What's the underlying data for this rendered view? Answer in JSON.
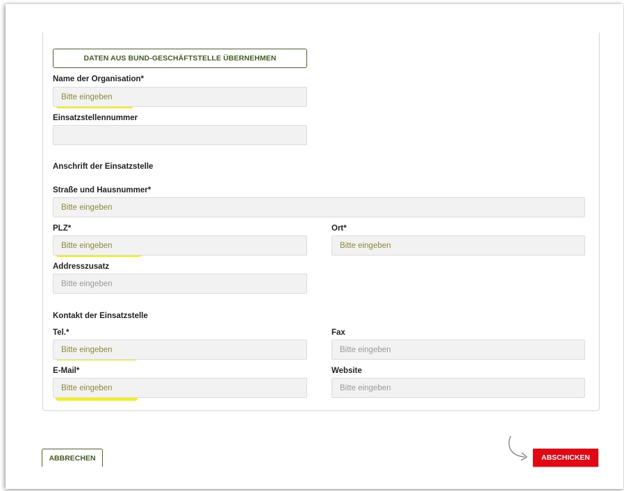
{
  "form": {
    "takeover_button_label": "DATEN AUS BUND-GESCHÄFTSTELLE ÜBERNEHMEN",
    "placeholder": "Bitte eingeben",
    "fields": {
      "organisation_name": {
        "label": "Name der Organisation*",
        "value": "",
        "highlighted": true
      },
      "einsatzstellennummer": {
        "label": "Einsatzstellennummer",
        "value": "",
        "highlighted": false
      },
      "strasse": {
        "label": "Straße und Hausnummer*",
        "value": "",
        "highlighted": true
      },
      "plz": {
        "label": "PLZ*",
        "value": "",
        "highlighted": true
      },
      "ort": {
        "label": "Ort*",
        "value": "",
        "highlighted": true
      },
      "addresszusatz": {
        "label": "Addresszusatz",
        "value": "",
        "highlighted": false
      },
      "tel": {
        "label": "Tel.*",
        "value": "",
        "highlighted": true
      },
      "fax": {
        "label": "Fax",
        "value": "",
        "highlighted": false
      },
      "email": {
        "label": "E-Mail*",
        "value": "",
        "highlighted": true
      },
      "website": {
        "label": "Website",
        "value": "",
        "highlighted": false
      }
    },
    "sections": {
      "anschrift": "Anschrift der Einsatzstelle",
      "kontakt": "Kontakt der Einsatzstelle"
    }
  },
  "actions": {
    "cancel_label": "ABBRECHEN",
    "submit_label": "ABSCHICKEN"
  },
  "colors": {
    "accent_green": "#3f5e1d",
    "submit_red": "#e30613",
    "highlight_yellow": "#f4f000"
  },
  "icons": {
    "submit_hint": "curved-arrow-icon"
  }
}
